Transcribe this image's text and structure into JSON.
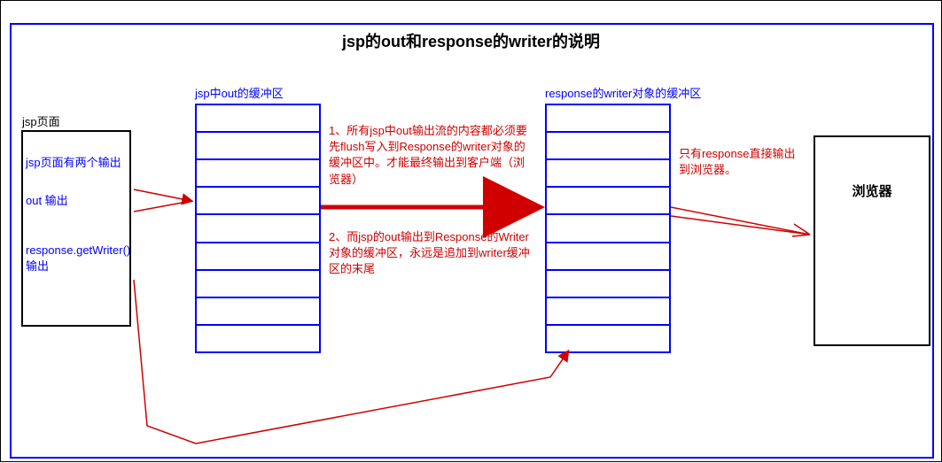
{
  "title": "jsp的out和response的writer的说明",
  "labels": {
    "jspBufferTitle": "jsp中out的缓冲区",
    "responseBufferTitle": "response的writer对象的缓冲区",
    "jspPageTitle": "jsp页面",
    "jspPageItems": {
      "a": "jsp页面有两个输出",
      "b": "out 输出",
      "c": "response.getWriter() 输出"
    },
    "browser": "浏览器",
    "note1": "1、所有jsp中out输出流的内容都必须要先flush写入到Response的writer对象的缓冲区中。才能最终输出到客户端（浏览器）",
    "note2": "2、而jsp的out输出到Response的Writer对象的缓冲区，永远是追加到writer缓冲区的末尾",
    "note3": "只有response直接输出到浏览器。"
  },
  "geometry": {
    "bufferRows": 9
  }
}
